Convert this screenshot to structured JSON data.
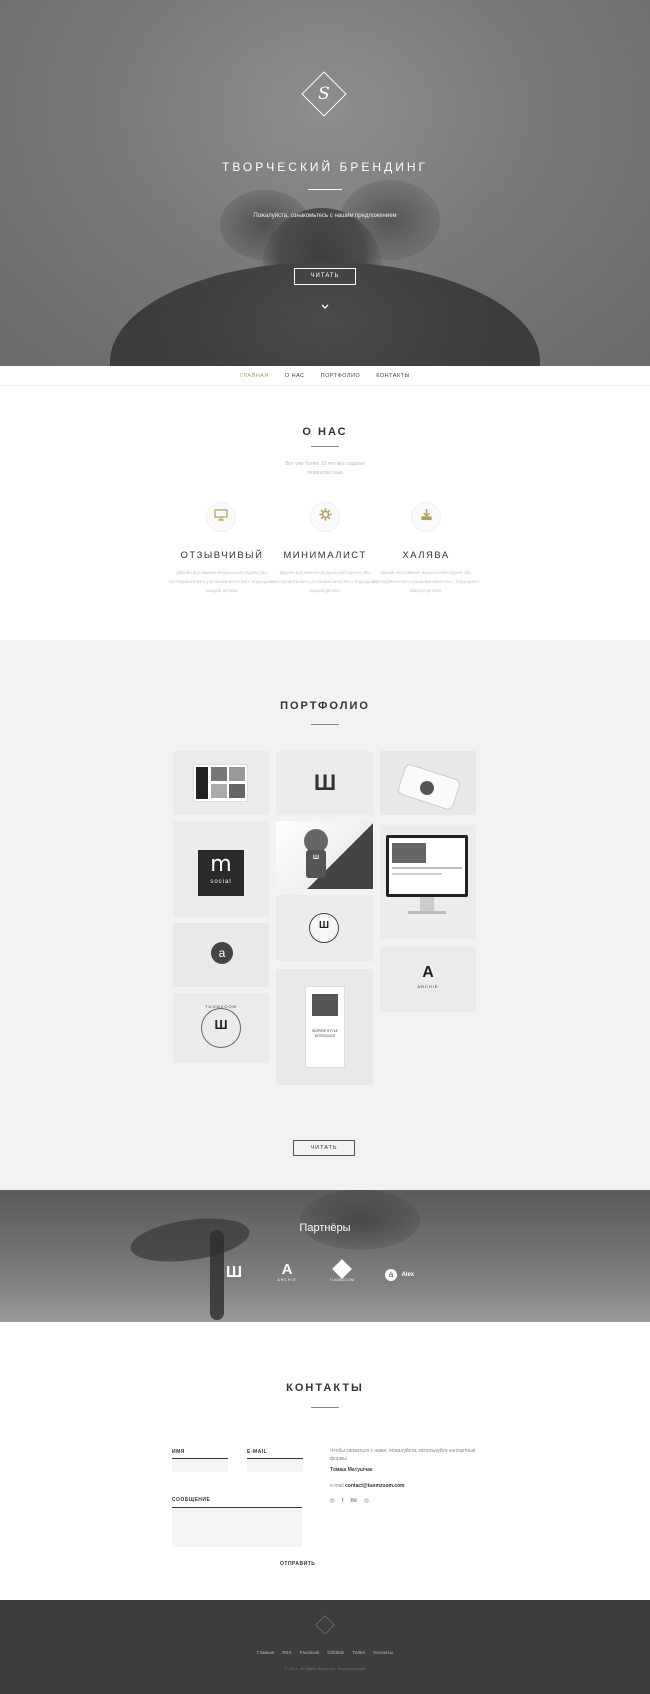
{
  "hero": {
    "logo_letter": "S",
    "title": "ТВОРЧЕСКИЙ БРЕНДИНГ",
    "subtitle": "Пожалуйста, ознакомьтесь с нашим предложением",
    "button_label": "ЧИТАТЬ",
    "scroll_icon": "chevron-down-icon"
  },
  "nav": {
    "items": [
      "ГЛАВНАЯ",
      "О НАС",
      "ПОРТФОЛИО",
      "КОНТАКТЫ"
    ],
    "active_index": 0
  },
  "about": {
    "title": "О НАС",
    "subtitle": "Вот уже более 10 лет мы создаем первоклассные",
    "features": [
      {
        "icon": "monitor-icon",
        "title": "ОТЗЫВЧИВЫЙ",
        "text": "Дизайн все важнее визуальной подачи. Мы последовательно улучшаем качество с подходом к каждой детали."
      },
      {
        "icon": "gear-icon",
        "title": "МИНИМАЛИСТ",
        "text": "Дизайн все важнее визуальной подачи. Мы последовательно улучшаем качество с подходом к каждой детали."
      },
      {
        "icon": "download-icon",
        "title": "ХАЛЯВА",
        "text": "Дизайн все важнее визуальной подачи. Мы последовательно улучшаем качество с подходом к каждой детали."
      }
    ]
  },
  "portfolio": {
    "title": "ПОРТФОЛИО",
    "button_label": "ЧИТАТЬ",
    "tiles": {
      "social_letter": "m",
      "social_word": "social",
      "a_letter": "a",
      "badge_word": "TUOMZOOM",
      "archie_letter": "A",
      "archie_word": "ARCHIE",
      "card_title": "INSPIRE STYLE INTRODUCE"
    }
  },
  "partners": {
    "title": "Партнёры",
    "logos": [
      {
        "icon": "w-mark-icon",
        "label": ""
      },
      {
        "icon": "archie-icon",
        "label": "ARCHIE"
      },
      {
        "icon": "tuomzoom-icon",
        "label": "TUOMZOOM"
      },
      {
        "icon": "alex-icon",
        "label": "Alex"
      }
    ]
  },
  "contacts": {
    "title": "КОНТАКТЫ",
    "name_label": "ИМЯ",
    "email_label": "E-MAIL",
    "message_label": "СООБЩЕНИЕ",
    "send_label": "ОТПРАВИТЬ",
    "intro": "Чтобы связаться с нами, пожалуйста, используйте контактные формы",
    "person": "Томаш Матушчак",
    "email_prefix": "e-mail",
    "email": "contact@tuomzoom.com",
    "socials": [
      "dribbble-icon",
      "facebook-icon",
      "behance-icon",
      "instagram-icon"
    ],
    "social_glyphs": [
      "◎",
      "f",
      "Bē",
      "◎"
    ]
  },
  "footer": {
    "links": [
      "Главная",
      "RSS",
      "Facebook",
      "Dribbble",
      "Twitter",
      "Контакты"
    ],
    "copyright": "© 2014. All Rights Reserved. Tuomzoom.com"
  },
  "colors": {
    "accent": "#a89a5a",
    "icon_gold": "#b49c60",
    "footer_bg": "#3d3d3d",
    "portfolio_bg": "#f2f2f2"
  }
}
